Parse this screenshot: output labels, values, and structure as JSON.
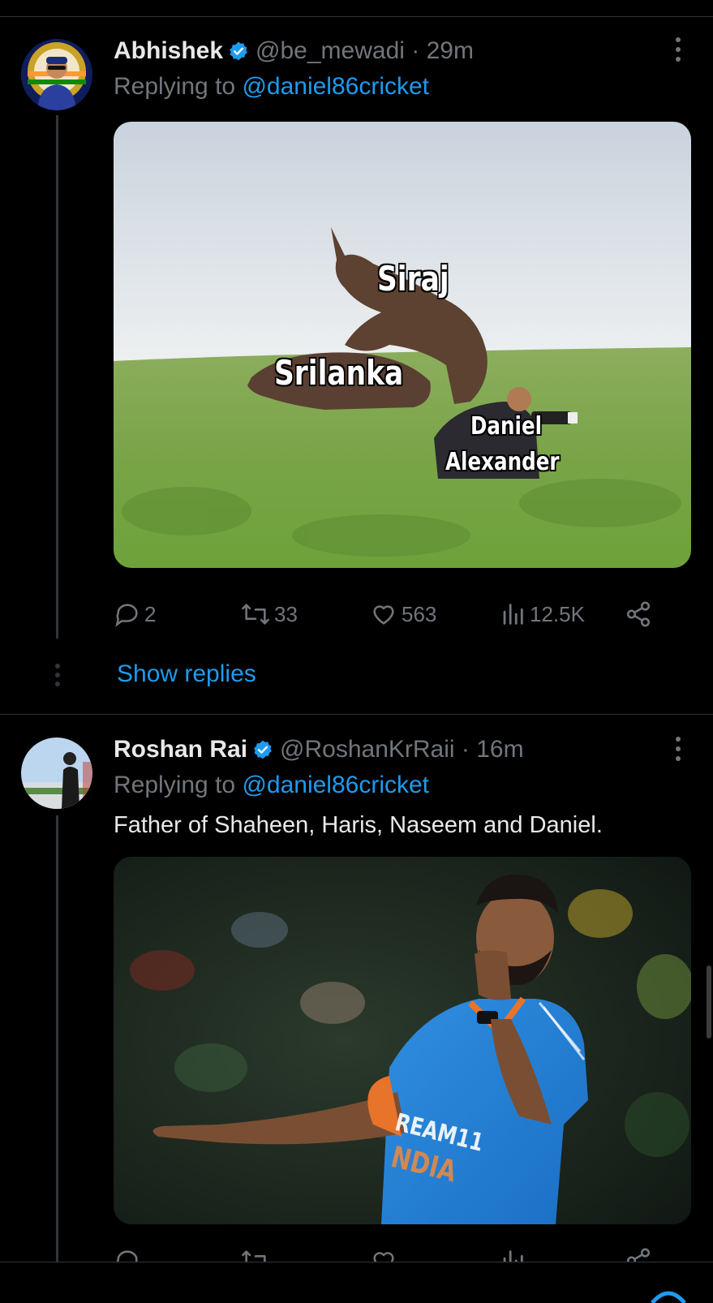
{
  "tweets": [
    {
      "name": "Abhishek",
      "handle": "@be_mewadi · 29m",
      "replying_prefix": "Replying to ",
      "replying_to": "@daniel86cricket",
      "meme_labels": [
        "Siraj",
        "Srilanka",
        "Daniel",
        "Alexander"
      ],
      "stats": {
        "replies": "2",
        "retweets": "33",
        "likes": "563",
        "views": "12.5K"
      },
      "show_replies": "Show replies"
    },
    {
      "name": "Roshan Rai",
      "handle": "@RoshanKrRaii · 16m",
      "replying_prefix": "Replying to ",
      "replying_to": "@daniel86cricket",
      "text": "Father of Shaheen, Haris, Naseem and Daniel.",
      "jersey_text": [
        "REAM11",
        "NDIA"
      ]
    }
  ],
  "colors": {
    "accent": "#1d9bf0",
    "muted": "#71767b",
    "background": "#000000"
  },
  "icons": [
    "verified-badge-icon",
    "more-options-icon",
    "reply-icon",
    "retweet-icon",
    "like-icon",
    "views-icon",
    "share-icon"
  ]
}
